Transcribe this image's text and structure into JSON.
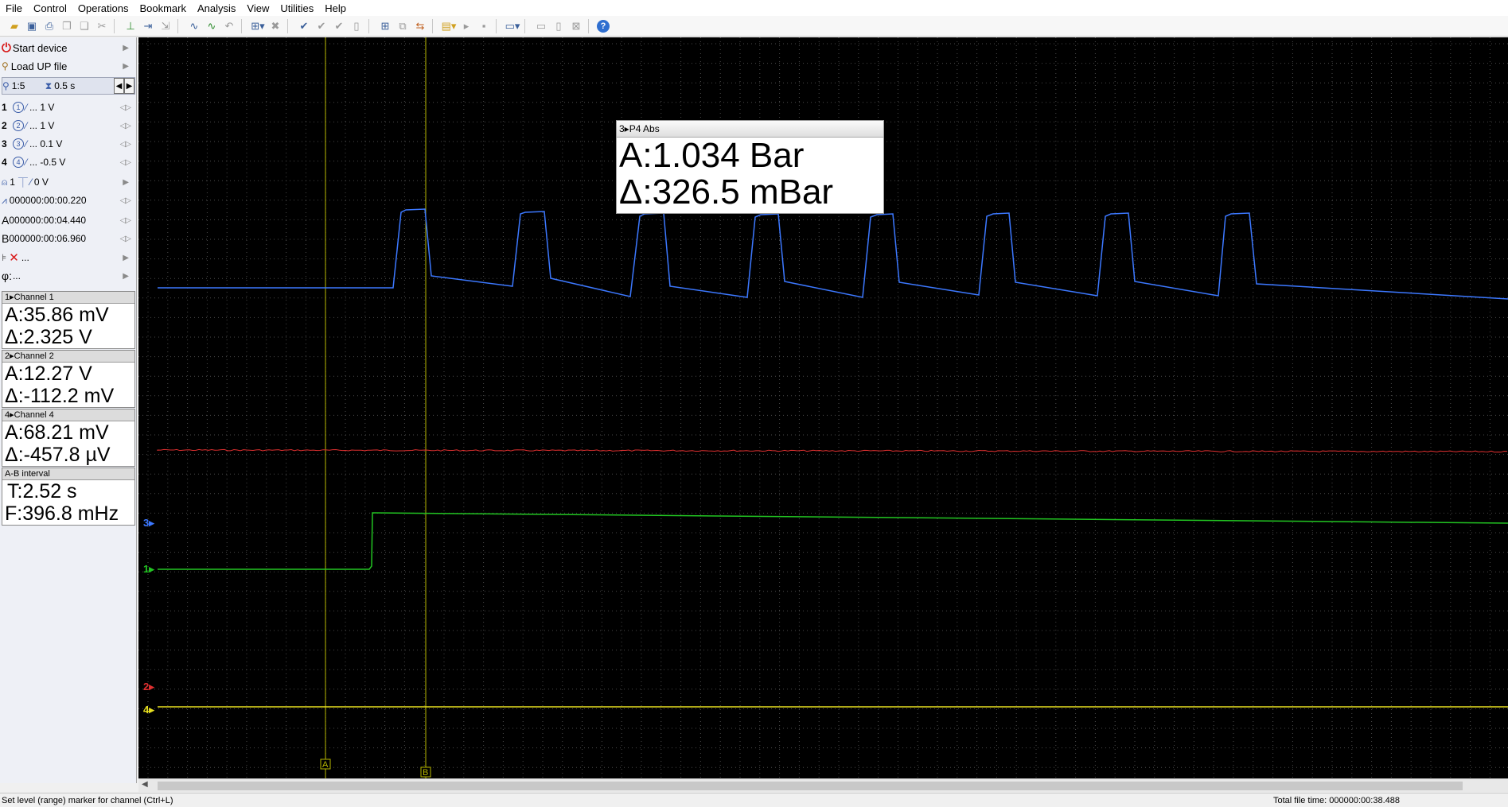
{
  "menu": [
    "File",
    "Control",
    "Operations",
    "Bookmark",
    "Analysis",
    "View",
    "Utilities",
    "Help"
  ],
  "left_panel": {
    "start_device": "Start device",
    "load_up_file": "Load UP file",
    "zoom_ratio": "1:5",
    "time_div": "0.5 s",
    "channels": [
      {
        "num": "1",
        "icon": "1",
        "value": "... 1 V"
      },
      {
        "num": "2",
        "icon": "2",
        "value": "... 1 V"
      },
      {
        "num": "3",
        "icon": "3",
        "value": "... 0.1 V"
      },
      {
        "num": "4",
        "icon": "4",
        "value": "... -0.5 V"
      }
    ],
    "trigger": {
      "channel": "1",
      "level": "0 V"
    },
    "pretrigger": "000000:00:00.220",
    "marker_a": "000000:00:04.440",
    "marker_b": "000000:00:06.960",
    "filter": "...",
    "phase": "..."
  },
  "readouts": [
    {
      "header": "Channel 1",
      "a": "A:35.86 mV",
      "d": "Δ:2.325 V"
    },
    {
      "header": "Channel 2",
      "a": "A:12.27 V",
      "d": "Δ:-112.2 mV"
    },
    {
      "header": "Channel 4",
      "a": "A:68.21 mV",
      "d": "Δ:-457.8 µV"
    },
    {
      "header": "A-B interval",
      "a": "T:2.52 s",
      "d": "F:396.8 mHz"
    }
  ],
  "popup": {
    "title": "P4 Abs",
    "a": "A:1.034 Bar",
    "d": "Δ:326.5 mBar"
  },
  "scope": {
    "marker_a_label": "A",
    "marker_b_label": "B",
    "channel_markers": [
      {
        "label": "3",
        "color": "#3c78ff"
      },
      {
        "label": "1",
        "color": "#22c522"
      },
      {
        "label": "2",
        "color": "#e03030"
      },
      {
        "label": "4",
        "color": "#e8e020"
      }
    ]
  },
  "status": {
    "hint": "Set level (range) marker for channel (Ctrl+L)",
    "total_time": "Total file time: 000000:00:38.488"
  },
  "colors": {
    "background": "#000000",
    "grid": "#5a5a5a",
    "ch1": "#22c522",
    "ch2": "#e03030",
    "ch3": "#3c78ff",
    "ch4": "#e8e020",
    "cursor": "#b8b800"
  }
}
